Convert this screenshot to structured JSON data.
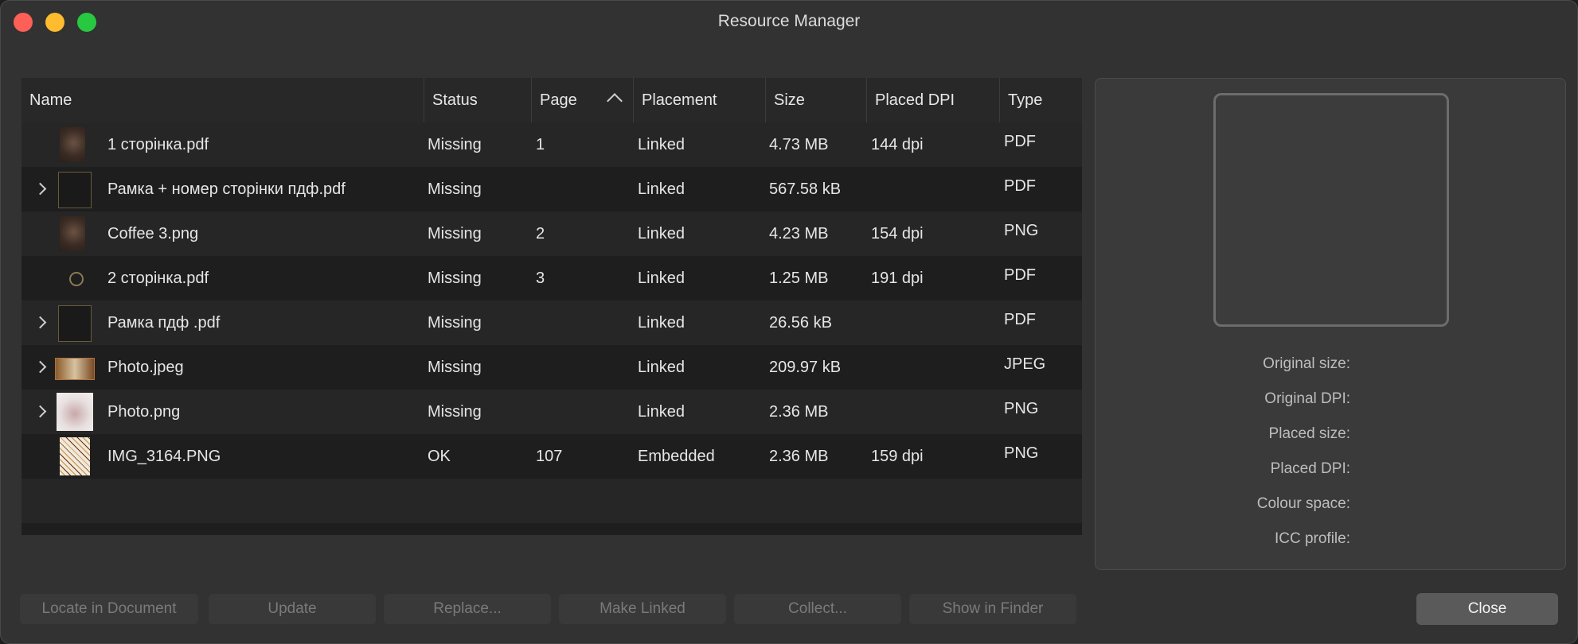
{
  "window": {
    "title": "Resource Manager"
  },
  "table": {
    "columns": {
      "name": "Name",
      "status": "Status",
      "page": "Page",
      "placement": "Placement",
      "size": "Size",
      "placed_dpi": "Placed DPI",
      "type": "Type"
    },
    "sort_icon": "chevron-up-icon",
    "rows": [
      {
        "name": "1 сторінка.pdf",
        "status": "Missing",
        "page": "1",
        "placement": "Linked",
        "size": "4.73 MB",
        "dpi": "144 dpi",
        "type": "PDF",
        "expandable": false,
        "thumb": "coffee-thumbnail"
      },
      {
        "name": "Рамка + номер сторінки пдф.pdf",
        "status": "Missing",
        "page": "",
        "placement": "Linked",
        "size": "567.58 kB",
        "dpi": "",
        "type": "PDF",
        "expandable": true,
        "thumb": "frame-thumbnail"
      },
      {
        "name": "Coffee 3.png",
        "status": "Missing",
        "page": "2",
        "placement": "Linked",
        "size": "4.23 MB",
        "dpi": "154 dpi",
        "type": "PNG",
        "expandable": false,
        "thumb": "coffee-thumbnail"
      },
      {
        "name": "2 сторінка.pdf",
        "status": "Missing",
        "page": "3",
        "placement": "Linked",
        "size": "1.25 MB",
        "dpi": "191 dpi",
        "type": "PDF",
        "expandable": false,
        "thumb": "circle-thumbnail"
      },
      {
        "name": "Рамка пдф .pdf",
        "status": "Missing",
        "page": "",
        "placement": "Linked",
        "size": "26.56 kB",
        "dpi": "",
        "type": "PDF",
        "expandable": true,
        "thumb": "frame-thumbnail"
      },
      {
        "name": "Photo.jpeg",
        "status": "Missing",
        "page": "",
        "placement": "Linked",
        "size": "209.97 kB",
        "dpi": "",
        "type": "JPEG",
        "expandable": true,
        "thumb": "photo-thumbnail"
      },
      {
        "name": "Photo.png",
        "status": "Missing",
        "page": "",
        "placement": "Linked",
        "size": "2.36 MB",
        "dpi": "",
        "type": "PNG",
        "expandable": true,
        "thumb": "photo-png-thumbnail"
      },
      {
        "name": "IMG_3164.PNG",
        "status": "OK",
        "page": "107",
        "placement": "Embedded",
        "size": "2.36 MB",
        "dpi": "159 dpi",
        "type": "PNG",
        "expandable": false,
        "thumb": "img-thumbnail"
      }
    ]
  },
  "info": {
    "original_size": "Original size:",
    "original_dpi": "Original DPI:",
    "placed_size": "Placed size:",
    "placed_dpi": "Placed DPI:",
    "colour_space": "Colour space:",
    "icc_profile": "ICC profile:"
  },
  "buttons": {
    "locate": "Locate in Document",
    "update": "Update",
    "replace": "Replace...",
    "make_linked": "Make Linked",
    "collect": "Collect...",
    "show_in_finder": "Show in Finder",
    "close": "Close"
  }
}
